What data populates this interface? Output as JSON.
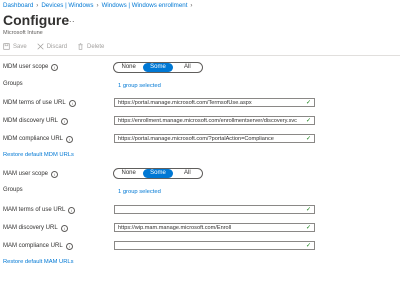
{
  "breadcrumb": [
    "Dashboard",
    "Devices | Windows",
    "Windows | Windows enrollment"
  ],
  "page": {
    "title": "Configure",
    "subtitle": "Microsoft Intune",
    "more": "..."
  },
  "toolbar": {
    "save": "Save",
    "discard": "Discard",
    "delete": "Delete"
  },
  "mdm": {
    "scope_label": "MDM user scope",
    "scope_options": [
      "None",
      "Some",
      "All"
    ],
    "scope_selected": "Some",
    "groups_label": "Groups",
    "groups_value": "1 group selected",
    "terms_label": "MDM terms of use URL",
    "terms_value": "https://portal.manage.microsoft.com/TermsofUse.aspx",
    "discovery_label": "MDM discovery URL",
    "discovery_value": "https://enrollment.manage.microsoft.com/enrollmentserver/discovery.svc",
    "compliance_label": "MDM compliance URL",
    "compliance_value": "https://portal.manage.microsoft.com/?portalAction=Compliance",
    "restore": "Restore default MDM URLs"
  },
  "mam": {
    "scope_label": "MAM user scope",
    "scope_options": [
      "None",
      "Some",
      "All"
    ],
    "scope_selected": "Some",
    "groups_label": "Groups",
    "groups_value": "1 group selected",
    "terms_label": "MAM terms of use URL",
    "terms_value": "",
    "discovery_label": "MAM discovery URL",
    "discovery_value": "https://wip.mam.manage.microsoft.com/Enroll",
    "compliance_label": "MAM compliance URL",
    "compliance_value": "",
    "restore": "Restore default MAM URLs"
  },
  "colors": {
    "accent": "#0078d4",
    "valid": "#107c10"
  }
}
